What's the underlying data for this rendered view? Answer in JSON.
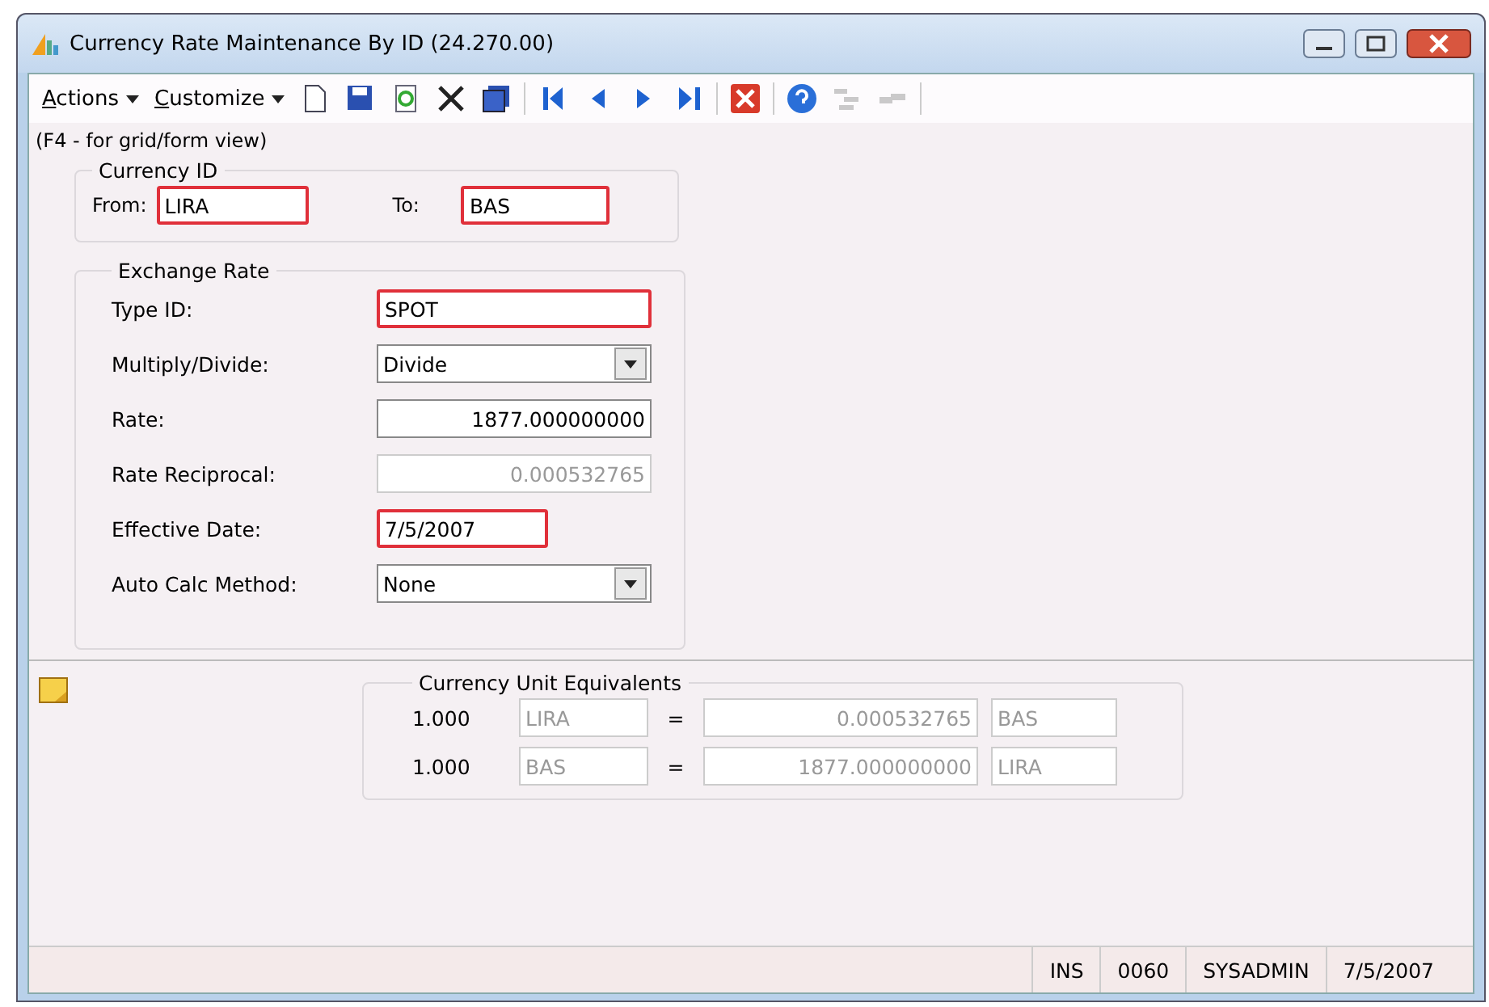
{
  "window": {
    "title": "Currency Rate Maintenance By ID (24.270.00)"
  },
  "menus": [
    {
      "label": "Actions"
    },
    {
      "label": "Customize"
    }
  ],
  "toolbar": [
    {
      "kind": "new",
      "disabled": false
    },
    {
      "kind": "save",
      "disabled": false
    },
    {
      "kind": "refresh",
      "disabled": false
    },
    {
      "kind": "delete",
      "disabled": false
    },
    {
      "kind": "saveall",
      "disabled": false
    },
    {
      "kind": "sep"
    },
    {
      "kind": "first",
      "disabled": false
    },
    {
      "kind": "prev",
      "disabled": false
    },
    {
      "kind": "next",
      "disabled": false
    },
    {
      "kind": "last",
      "disabled": false
    },
    {
      "kind": "sep"
    },
    {
      "kind": "close",
      "disabled": false
    },
    {
      "kind": "sep"
    },
    {
      "kind": "help",
      "disabled": false
    },
    {
      "kind": "tree",
      "disabled": true
    },
    {
      "kind": "link",
      "disabled": true
    },
    {
      "kind": "sep"
    }
  ],
  "hint": "(F4 - for grid/form view)",
  "currency_id": {
    "title": "Currency ID",
    "from": {
      "label": "From:",
      "value": "LIRA",
      "required": true
    },
    "to": {
      "label": "To:",
      "value": "BAS",
      "required": true
    }
  },
  "exchange_rate": {
    "title": "Exchange Rate",
    "fields": [
      {
        "label": "Type ID:",
        "value": "SPOT",
        "kind": "text",
        "required": true,
        "disabled": false
      },
      {
        "label": "Multiply/Divide:",
        "value": "Divide",
        "kind": "select",
        "required": false,
        "disabled": false
      },
      {
        "label": "Rate:",
        "value": "1877.000000000",
        "kind": "number",
        "required": false,
        "disabled": false
      },
      {
        "label": "Rate Reciprocal:",
        "value": "0.000532765",
        "kind": "number",
        "required": false,
        "disabled": true
      },
      {
        "label": "Effective Date:",
        "value": "7/5/2007",
        "kind": "date",
        "required": true,
        "disabled": false
      },
      {
        "label": "Auto Calc Method:",
        "value": "None",
        "kind": "select",
        "required": false,
        "disabled": false
      }
    ]
  },
  "equivalents": {
    "title": "Currency Unit Equivalents",
    "rows": [
      {
        "amount": "1.000",
        "from": "LIRA",
        "equals": "=",
        "value": "0.000532765",
        "to": "BAS"
      },
      {
        "amount": "1.000",
        "from": "BAS",
        "equals": "=",
        "value": "1877.000000000",
        "to": "LIRA"
      }
    ]
  },
  "status_bar": [
    "INS",
    "0060",
    "SYSADMIN",
    "7/5/2007"
  ]
}
